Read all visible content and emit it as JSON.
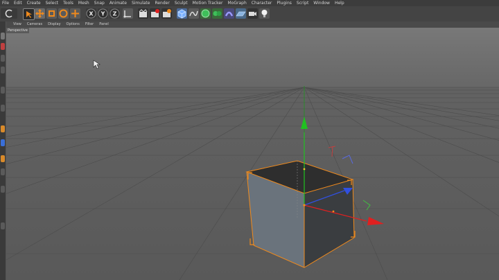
{
  "menu": {
    "items": [
      "File",
      "Edit",
      "Create",
      "Select",
      "Tools",
      "Mesh",
      "Snap",
      "Animate",
      "Simulate",
      "Render",
      "Sculpt",
      "Motion Tracker",
      "MoGraph",
      "Character",
      "Plugins",
      "Script",
      "Window",
      "Help"
    ]
  },
  "toolbar": {
    "axis_x_label": "X",
    "axis_y_label": "Y",
    "axis_z_label": "Z"
  },
  "viewport": {
    "menu": [
      "View",
      "Cameras",
      "Display",
      "Options",
      "Filter",
      "Panel"
    ],
    "camera_label": "Perspective"
  },
  "colors": {
    "accent_orange": "#f08a1c",
    "axis_x": "#e02020",
    "axis_y": "#20c020",
    "axis_z": "#3050e0",
    "toolbar_blue": "#3a6fd8"
  }
}
